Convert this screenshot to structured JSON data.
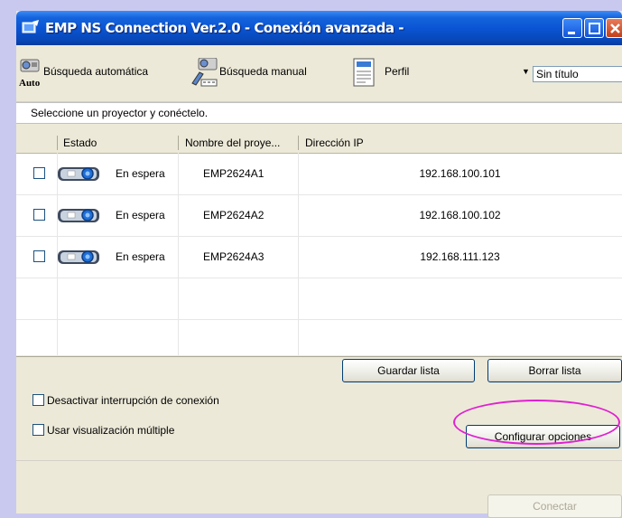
{
  "window": {
    "title": "EMP NS Connection Ver.2.0 - Conexión avanzada -"
  },
  "toolbar": {
    "auto_search_label": "Búsqueda automática",
    "auto_badge": "Auto",
    "manual_search_label": "Búsqueda manual",
    "profile_label": "Perfil",
    "profile_select_value": "Sin título"
  },
  "instructions": "Seleccione un proyector y conéctelo.",
  "table": {
    "columns": {
      "status": "Estado",
      "name": "Nombre del proye...",
      "ip": "Dirección IP"
    },
    "rows": [
      {
        "status": "En espera",
        "name": "EMP2624A1",
        "ip": "192.168.100.101",
        "checked": false
      },
      {
        "status": "En espera",
        "name": "EMP2624A2",
        "ip": "192.168.100.102",
        "checked": false
      },
      {
        "status": "En espera",
        "name": "EMP2624A3",
        "ip": "192.168.111.123",
        "checked": false
      }
    ]
  },
  "buttons": {
    "save_list": "Guardar lista",
    "clear_list": "Borrar lista",
    "configure_options": "Configurar opciones",
    "connect": "Conectar"
  },
  "options": {
    "disable_interrupt": {
      "label": "Desactivar interrupción de conexión",
      "checked": false
    },
    "multi_display": {
      "label": "Usar visualización múltiple",
      "checked": false
    }
  },
  "colors": {
    "titlebar": "#0a55d4",
    "highlight_ring": "#e020d0",
    "window_bg": "#ece9d8"
  }
}
